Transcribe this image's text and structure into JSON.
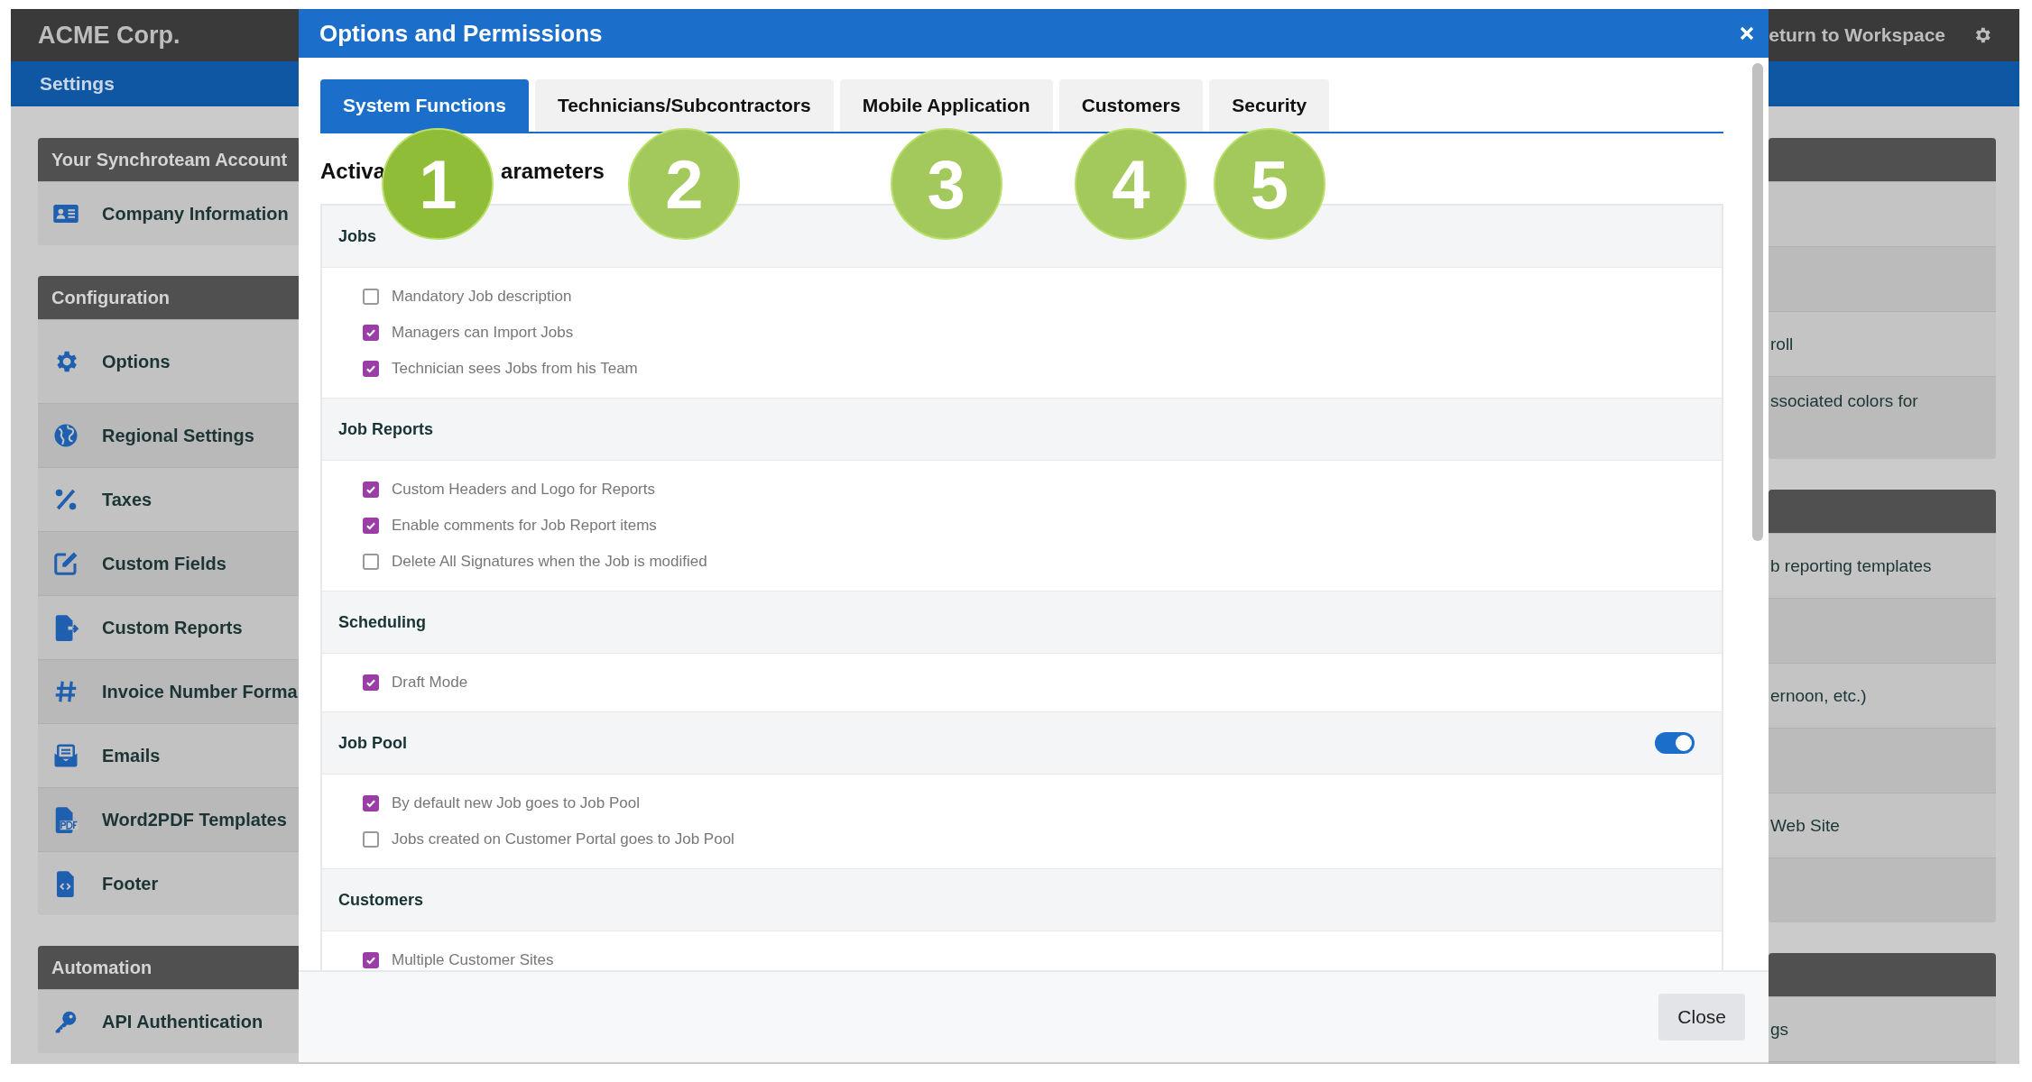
{
  "app": {
    "company": "ACME Corp.",
    "return_link": "eturn to Workspace",
    "breadcrumb": "Settings"
  },
  "sidebar": [
    {
      "title": "Your Synchroteam Account",
      "items": [
        {
          "label": "Company Information"
        }
      ]
    },
    {
      "title": "Configuration",
      "items": [
        {
          "label": "Options"
        },
        {
          "label": "Regional Settings"
        },
        {
          "label": "Taxes"
        },
        {
          "label": "Custom Fields"
        },
        {
          "label": "Custom Reports"
        },
        {
          "label": "Invoice Number Forma"
        },
        {
          "label": "Emails"
        },
        {
          "label": "Word2PDF Templates"
        },
        {
          "label": "Footer"
        }
      ]
    },
    {
      "title": "Automation",
      "items": [
        {
          "label": "API Authentication"
        }
      ]
    }
  ],
  "right_panels": [
    {
      "rows": [
        "roll",
        "ssociated colors for"
      ]
    },
    {
      "rows": [
        "b reporting templates",
        "ernoon, etc.)",
        "Web Site"
      ]
    },
    {
      "rows": [
        "gs"
      ]
    }
  ],
  "modal": {
    "title": "Options and Permissions",
    "tabs": [
      {
        "label": "System Functions",
        "selected": true,
        "callout": "1",
        "color": "#8fbd38"
      },
      {
        "label": "Technicians/Subcontractors",
        "selected": false,
        "callout": "2",
        "color": "#a3c95c"
      },
      {
        "label": "Mobile Application",
        "selected": false,
        "callout": "3",
        "color": "#a3c95c"
      },
      {
        "label": "Customers",
        "selected": false,
        "callout": "4",
        "color": "#a3c95c"
      },
      {
        "label": "Security",
        "selected": false,
        "callout": "5",
        "color": "#a3c95c"
      }
    ],
    "heading_parts": [
      "Activa",
      "arameters"
    ],
    "sections": [
      {
        "title": "Jobs",
        "options": [
          {
            "label": "Mandatory Job description",
            "checked": false
          },
          {
            "label": "Managers can Import Jobs",
            "checked": true
          },
          {
            "label": "Technician sees Jobs from his Team",
            "checked": true
          }
        ]
      },
      {
        "title": "Job Reports",
        "options": [
          {
            "label": "Custom Headers and Logo for Reports",
            "checked": true
          },
          {
            "label": "Enable comments for Job Report items",
            "checked": true
          },
          {
            "label": "Delete All Signatures when the Job is modified",
            "checked": false
          }
        ]
      },
      {
        "title": "Scheduling",
        "options": [
          {
            "label": "Draft Mode",
            "checked": true
          }
        ]
      },
      {
        "title": "Job Pool",
        "toggle": {
          "on": true
        },
        "options": [
          {
            "label": "By default new Job goes to Job Pool",
            "checked": true
          },
          {
            "label": "Jobs created on Customer Portal goes to Job Pool",
            "checked": false
          }
        ]
      },
      {
        "title": "Customers",
        "options": [
          {
            "label": "Multiple Customer Sites",
            "checked": true
          }
        ]
      }
    ],
    "close_button": "Close"
  }
}
